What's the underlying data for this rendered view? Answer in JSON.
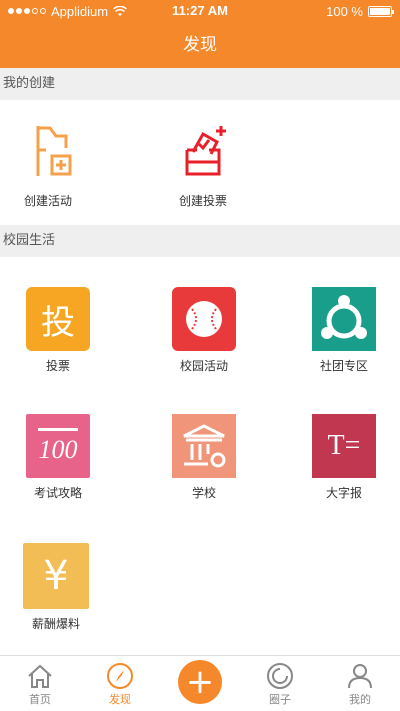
{
  "status_bar": {
    "carrier": "Applidium",
    "time": "11:27 AM",
    "battery": "100 %"
  },
  "header": {
    "title": "发现"
  },
  "my_create": {
    "section_title": "我的创建",
    "items": [
      {
        "label": "创建活动",
        "icon": "flag-plus-icon"
      },
      {
        "label": "创建投票",
        "icon": "ballot-box-icon"
      }
    ]
  },
  "campus_life": {
    "section_title": "校园生活",
    "items": [
      {
        "label": "投票",
        "icon": "vote-icon",
        "glyph": "投",
        "color": "#f6a623"
      },
      {
        "label": "校园活动",
        "icon": "baseball-icon",
        "color": "#e83a3a"
      },
      {
        "label": "社团专区",
        "icon": "club-icon",
        "color": "#1a9e8c"
      },
      {
        "label": "考试攻略",
        "icon": "score-100-icon",
        "glyph": "100",
        "color": "#e8638a"
      },
      {
        "label": "学校",
        "icon": "school-icon",
        "color": "#f0957a"
      },
      {
        "label": "大字报",
        "icon": "big-poster-icon",
        "glyph": "T=",
        "color": "#c0374f"
      },
      {
        "label": "薪酬爆料",
        "icon": "yen-icon",
        "glyph": "¥",
        "color": "#f2bd55"
      }
    ]
  },
  "bottom_nav": {
    "items": [
      {
        "label": "首页",
        "icon": "home-icon"
      },
      {
        "label": "发现",
        "icon": "compass-icon",
        "active": true
      },
      {
        "label": "",
        "icon": "plus-icon"
      },
      {
        "label": "圈子",
        "icon": "circle-icon"
      },
      {
        "label": "我的",
        "icon": "user-icon"
      }
    ]
  },
  "colors": {
    "accent": "#f5882a",
    "section_bg": "#efefef"
  }
}
